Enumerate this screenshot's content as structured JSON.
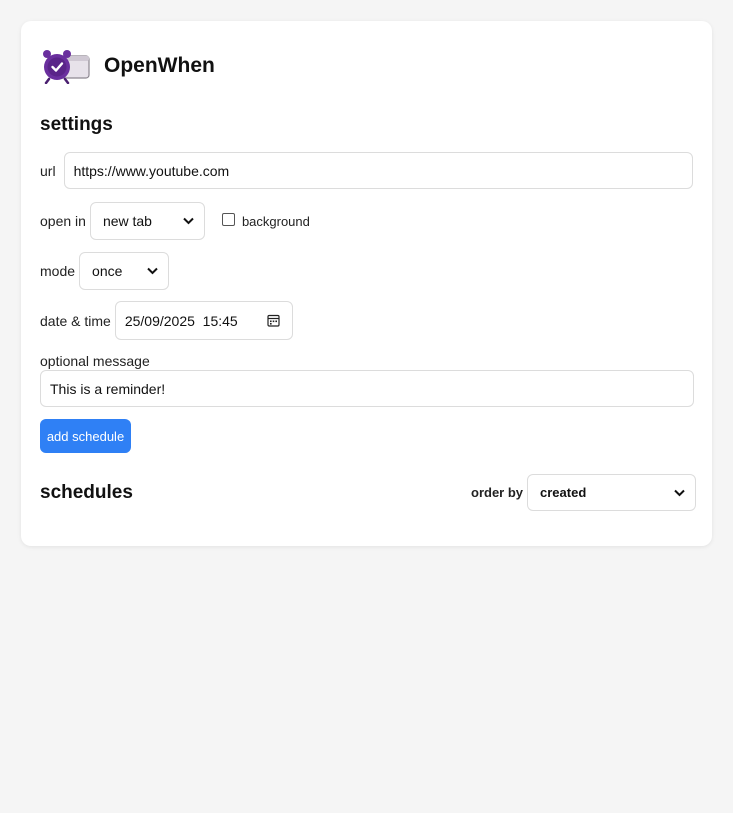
{
  "app": {
    "title": "OpenWhen",
    "logo_icon": "alarm-clock-window-icon"
  },
  "settings": {
    "heading": "settings",
    "url": {
      "label": "url",
      "value": "https://www.youtube.com"
    },
    "open_in": {
      "label": "open in",
      "selected": "new tab",
      "background_label": "background",
      "background_checked": false
    },
    "mode": {
      "label": "mode",
      "selected": "once"
    },
    "datetime": {
      "label": "date & time",
      "value": "25/09/2025  15:45",
      "icon": "calendar-icon"
    },
    "message": {
      "label": "optional message",
      "value": "This is a reminder!"
    },
    "add_button": "add schedule"
  },
  "schedules": {
    "heading": "schedules",
    "order_by_label": "order by",
    "order_by_selected": "created"
  },
  "colors": {
    "accent": "#2f80f5",
    "background": "#f5f5f5",
    "card": "#ffffff",
    "logo_purple": "#6a2f9e"
  }
}
